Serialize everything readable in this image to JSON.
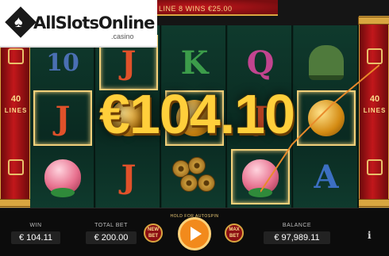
{
  "top": {
    "line_win_text": "LINE 8 WINS €25.00"
  },
  "logo": {
    "name": "AllSlotsOnline",
    "suffix": ".casino"
  },
  "side": {
    "lines_count": "40",
    "lines_word": "LINES"
  },
  "big_win": "€104.10",
  "reels": [
    [
      "10",
      "J",
      "peach"
    ],
    [
      "J",
      "orb",
      "J"
    ],
    [
      "K",
      "orb",
      "coins"
    ],
    [
      "Q",
      "J",
      "peach"
    ],
    [
      "bell",
      "gold",
      "A"
    ]
  ],
  "bottom": {
    "win_label": "WIN",
    "win_value": "€ 104.11",
    "total_bet_label": "TOTAL BET",
    "total_bet_value": "€ 200.00",
    "new_bet_label": "NEW BET",
    "spin_hint": "HOLD FOR AUTOSPIN",
    "max_bet_label": "MAX BET",
    "balance_label": "BALANCE",
    "balance_value": "€ 97,989.11",
    "info_label": "i"
  },
  "colors": {
    "frame_red": "#c2171b",
    "gold": "#d9a640",
    "reel_green": "#0c2e24",
    "win_yellow": "#ffcf3b",
    "spin_orange": "#f28a1c"
  },
  "icons": [
    "peach-icon",
    "gold-orb-icon",
    "coins-icon",
    "bell-icon",
    "play-icon",
    "info-icon"
  ]
}
